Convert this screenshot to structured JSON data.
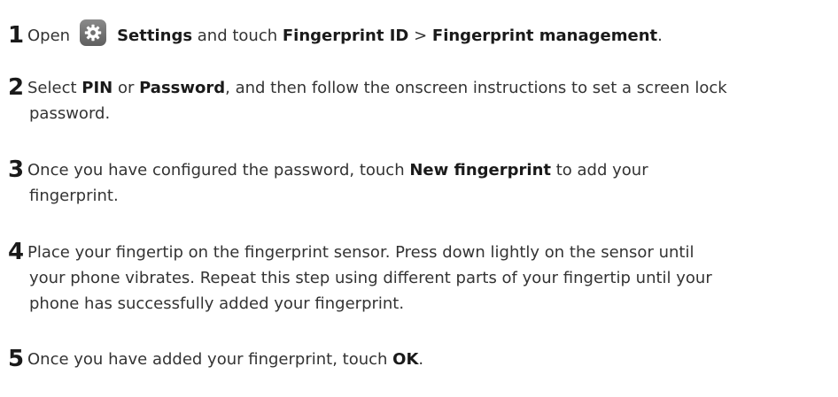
{
  "steps": [
    {
      "number": "1",
      "lines": [
        [
          {
            "t": "Open",
            "b": false
          },
          {
            "icon": "settings-gear-icon"
          },
          {
            "t": "Settings",
            "b": true
          },
          {
            "t": " and touch ",
            "b": false
          },
          {
            "t": "Fingerprint ID",
            "b": true
          },
          {
            "t": " > ",
            "b": false
          },
          {
            "t": "Fingerprint management",
            "b": true
          },
          {
            "t": ".",
            "b": false
          }
        ]
      ]
    },
    {
      "number": "2",
      "lines": [
        [
          {
            "t": "Select ",
            "b": false
          },
          {
            "t": "PIN",
            "b": true
          },
          {
            "t": " or ",
            "b": false
          },
          {
            "t": "Password",
            "b": true
          },
          {
            "t": ", and then follow the onscreen instructions to set a screen lock",
            "b": false
          }
        ],
        [
          {
            "t": "password.",
            "b": false
          }
        ]
      ]
    },
    {
      "number": "3",
      "lines": [
        [
          {
            "t": "Once you have configured the password, touch ",
            "b": false
          },
          {
            "t": "New fingerprint",
            "b": true
          },
          {
            "t": " to add your",
            "b": false
          }
        ],
        [
          {
            "t": "fingerprint.",
            "b": false
          }
        ]
      ]
    },
    {
      "number": "4",
      "lines": [
        [
          {
            "t": "Place your fingertip on the fingerprint sensor. Press down lightly on the sensor until",
            "b": false
          }
        ],
        [
          {
            "t": "your phone vibrates. Repeat this step using different parts of your fingertip until your",
            "b": false
          }
        ],
        [
          {
            "t": "phone has successfully added your fingerprint.",
            "b": false
          }
        ]
      ]
    },
    {
      "number": "5",
      "lines": [
        [
          {
            "t": "Once you have added your fingerprint, touch ",
            "b": false
          },
          {
            "t": "OK",
            "b": true
          },
          {
            "t": ".",
            "b": false
          }
        ]
      ]
    }
  ]
}
